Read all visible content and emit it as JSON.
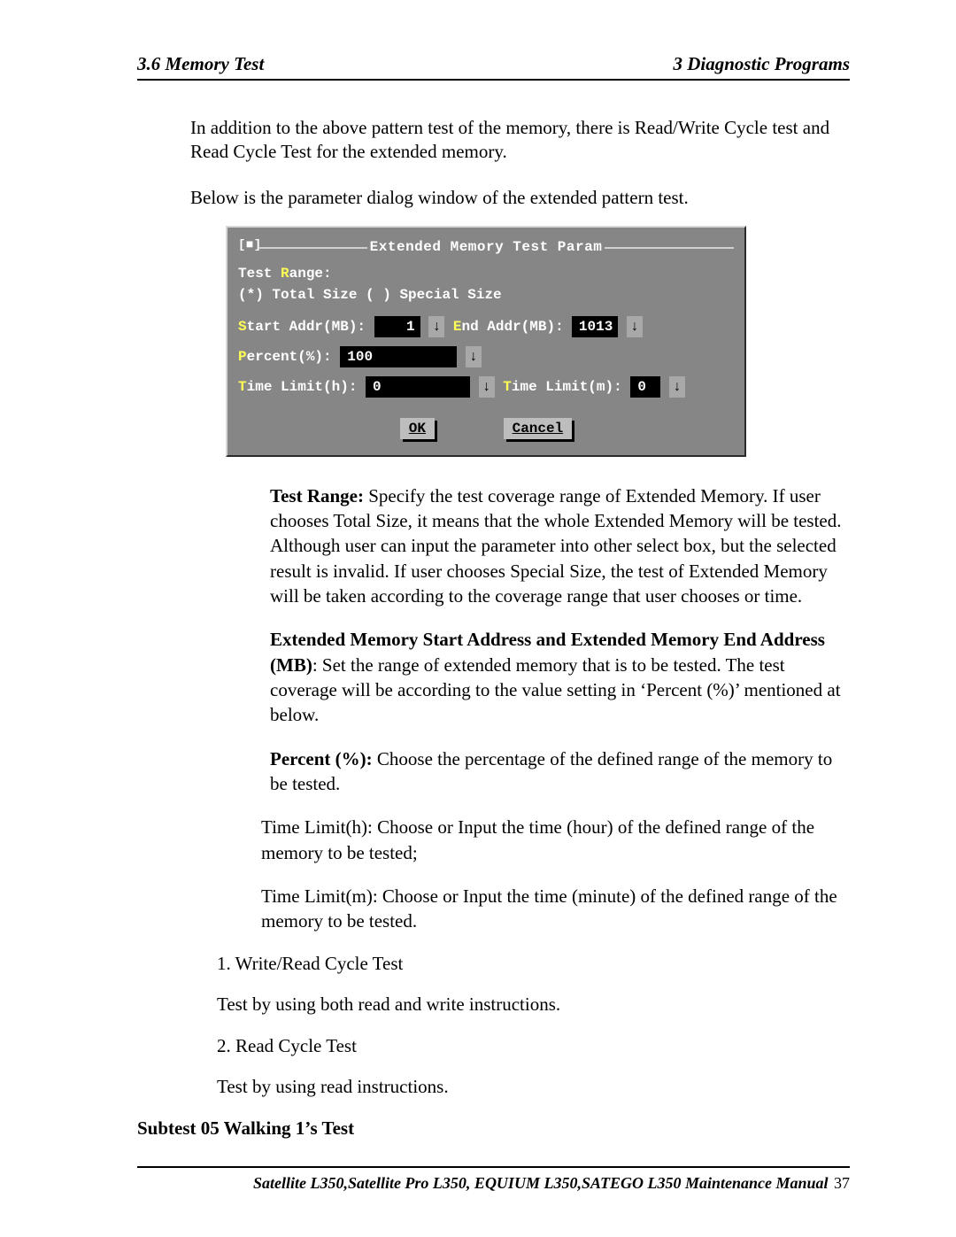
{
  "header": {
    "left": "3.6 Memory Test",
    "right": "3  Diagnostic Programs"
  },
  "intro1": "In addition to the above pattern test of the memory, there is Read/Write Cycle test and Read Cycle Test for the extended memory.",
  "intro2": "Below is the parameter dialog window of the extended pattern test.",
  "dialog": {
    "close_glyph": "[■]",
    "title": "Extended Memory Test Param",
    "test_range_label_pre": "Test ",
    "test_range_hot": "R",
    "test_range_label_post": "ange:",
    "total_size_radio": "(*) Total Size",
    "special_size_radio": "( ) Special Size",
    "start_hot": "S",
    "start_label": "tart Addr(MB):",
    "start_val": "1",
    "end_hot": "E",
    "end_label": "nd Addr(MB):",
    "end_val": "1013",
    "percent_hot": "P",
    "percent_label": "ercent(%):",
    "percent_val": "100",
    "th_hot": "T",
    "th_label": "ime Limit(h):",
    "th_val": "0",
    "tm_hot": "T",
    "tm_label": "ime Limit(m):",
    "tm_val": "0",
    "spin_glyph": "↓",
    "ok": "OK",
    "cancel": "Cancel"
  },
  "definitions": {
    "test_range": {
      "lead": "Test Range:",
      "body": " Specify the test coverage range of Extended Memory. If user chooses Total Size, it means that the whole Extended Memory will be tested. Although user can input the parameter into other select box, but the selected result is invalid. If user chooses Special Size, the test of Extended Memory will be taken according to the coverage range that user chooses or time."
    },
    "addr": {
      "lead": "Extended Memory Start Address and Extended Memory End Address (MB)",
      "body": ": Set the range of extended memory that is to be tested. The test coverage will be according to the value setting in ‘Percent (%)’ mentioned at below."
    },
    "percent": {
      "lead": "Percent (%):",
      "body": " Choose the percentage of the defined range of the memory to be tested."
    },
    "tlh": {
      "lead": "Time Limit(h):",
      "body": " Choose or Input the time (hour) of the defined range of the memory to be tested;"
    },
    "tlm": {
      "lead": "Time Limit(m):",
      "body": " Choose or Input the time (minute) of the defined range of the memory to be tested."
    }
  },
  "list": {
    "n1": "1.  Write/Read Cycle Test",
    "t1": "Test by using both read and write instructions.",
    "n2": "2.  Read Cycle Test",
    "t2": "Test by using read instructions."
  },
  "subtest": "Subtest 05  Walking 1’s Test",
  "footer": {
    "title": "Satellite L350,Satellite Pro L350, EQUIUM L350,SATEGO L350 Maintenance Manual",
    "page": " 37"
  }
}
